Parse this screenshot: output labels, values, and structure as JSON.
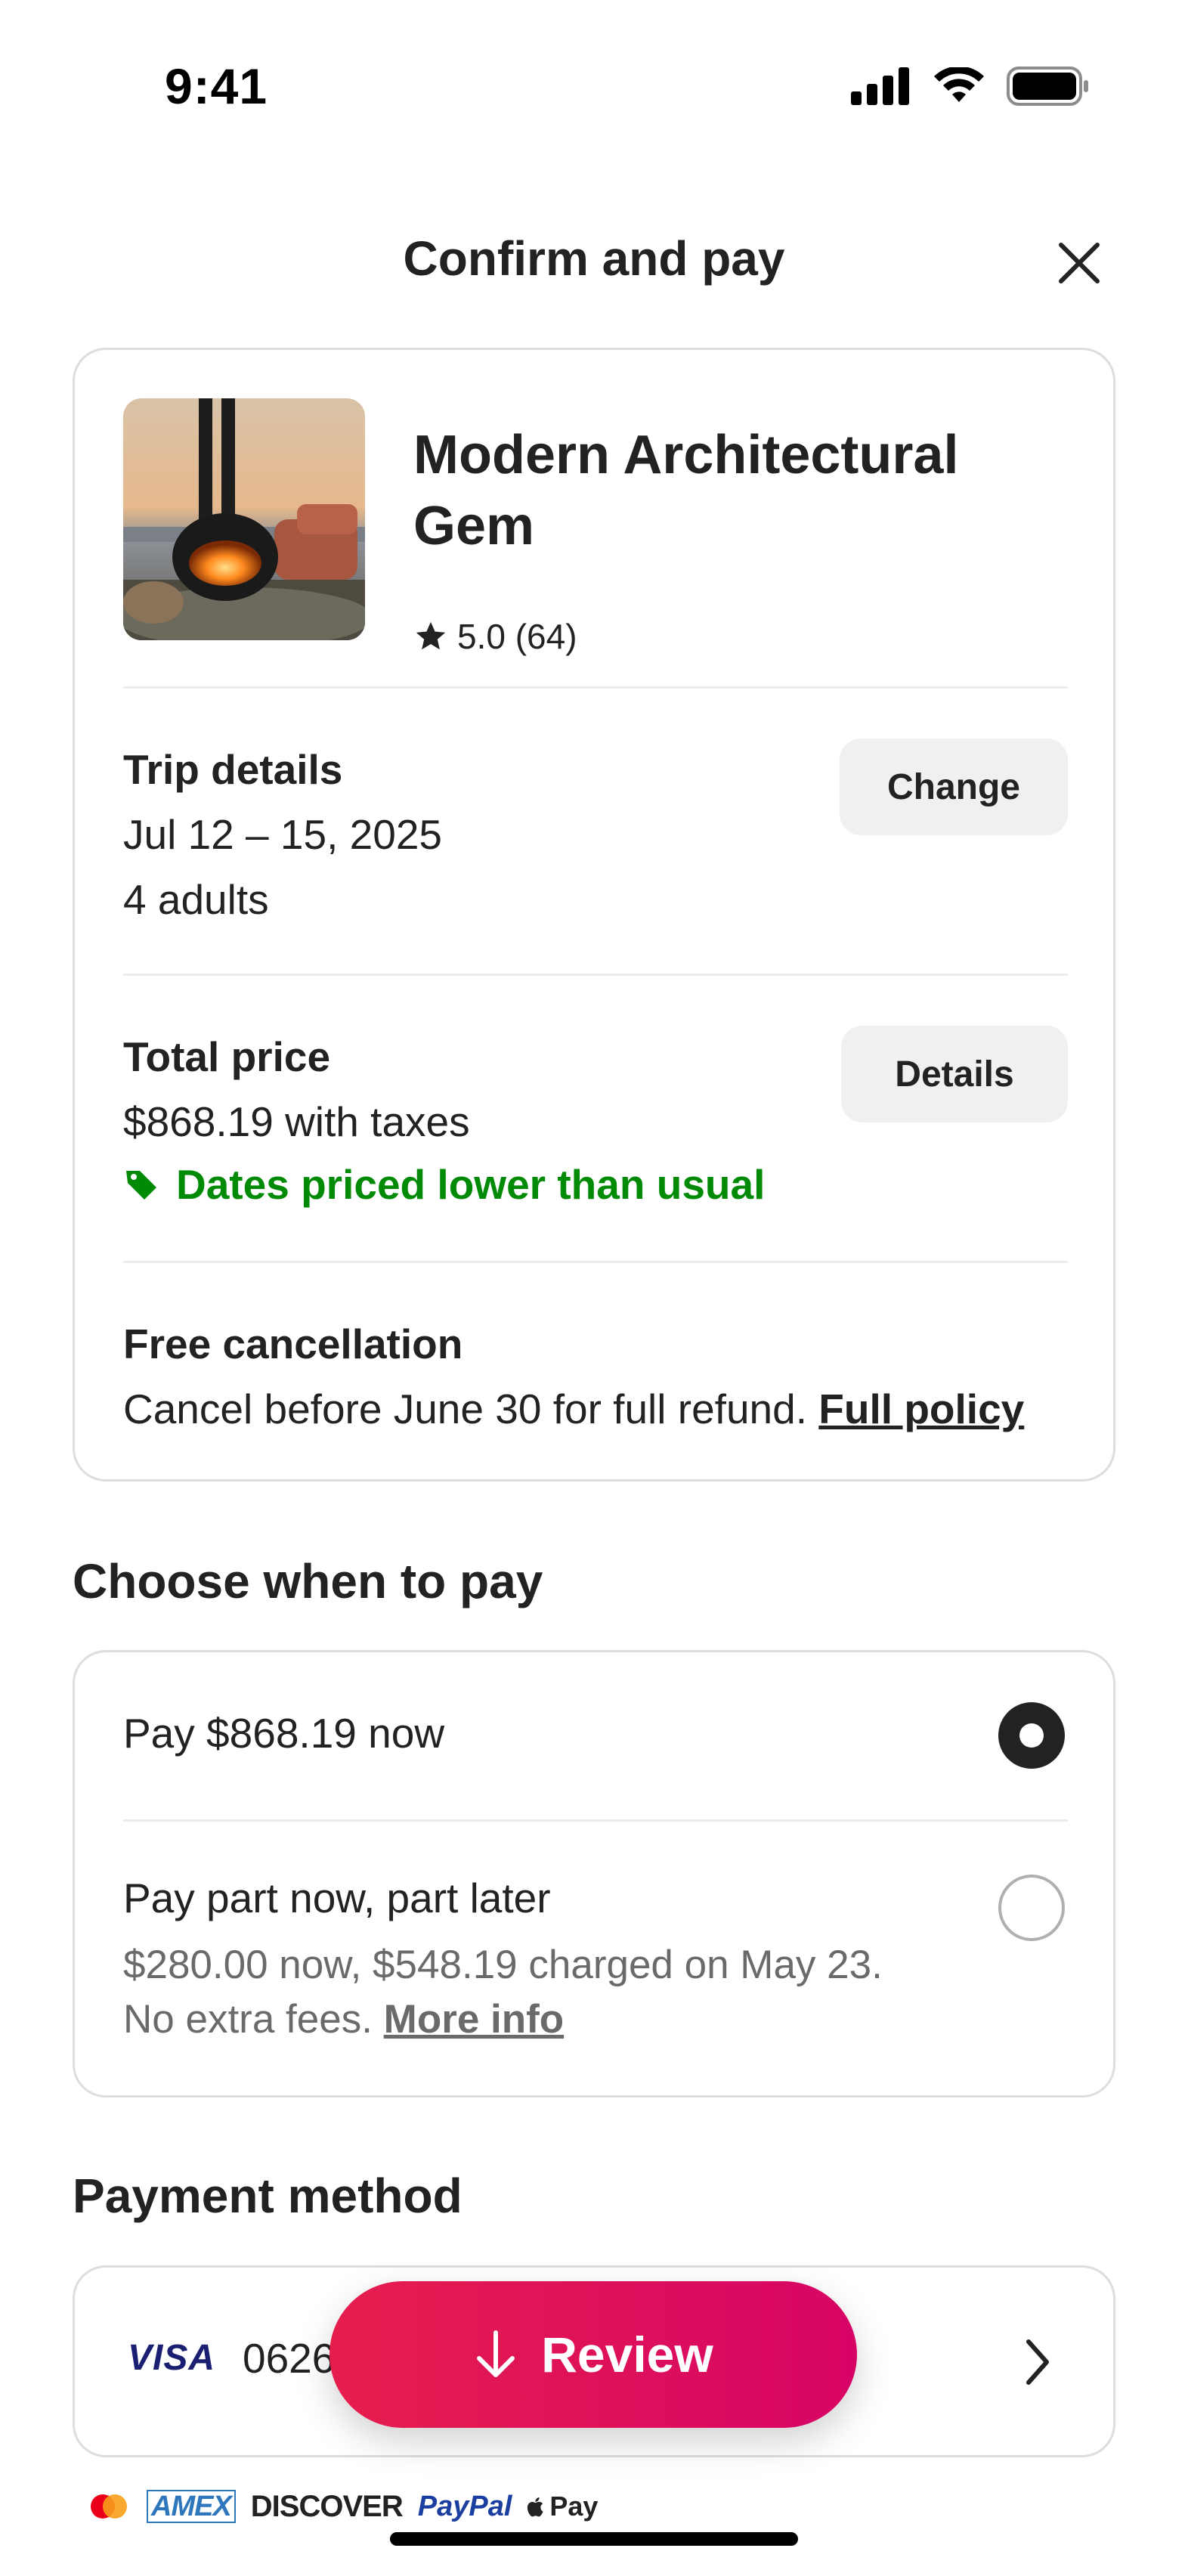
{
  "status_bar": {
    "time": "9:41"
  },
  "header": {
    "title": "Confirm and pay"
  },
  "listing": {
    "title": "Modern Architectural Gem",
    "rating": "5.0 (64)"
  },
  "trip": {
    "title": "Trip details",
    "dates": "Jul 12 – 15, 2025",
    "guests": "4 adults",
    "change_label": "Change"
  },
  "price": {
    "title": "Total price",
    "amount": "$868.19 with taxes",
    "deal": "Dates priced lower than usual",
    "details_label": "Details"
  },
  "cancellation": {
    "title": "Free cancellation",
    "text": "Cancel before June 30 for full refund.",
    "link": "Full policy"
  },
  "pay_when": {
    "heading": "Choose when to pay",
    "options": [
      {
        "label": "Pay $868.19 now",
        "selected": true
      },
      {
        "label": "Pay part now, part later",
        "sub": "$280.00 now, $548.19 charged on May 23.",
        "sub2": "No extra fees.",
        "link": "More info",
        "selected": false
      }
    ]
  },
  "payment_method": {
    "heading": "Payment method",
    "brand": "VISA",
    "digits": "0626"
  },
  "review_button": {
    "label": "Review"
  },
  "accepted": [
    "AMEX",
    "DISCOVER",
    "PayPal",
    "Pay"
  ],
  "colors": {
    "accent": "#e61e4d",
    "deal_green": "#008a05",
    "text": "#222222"
  }
}
